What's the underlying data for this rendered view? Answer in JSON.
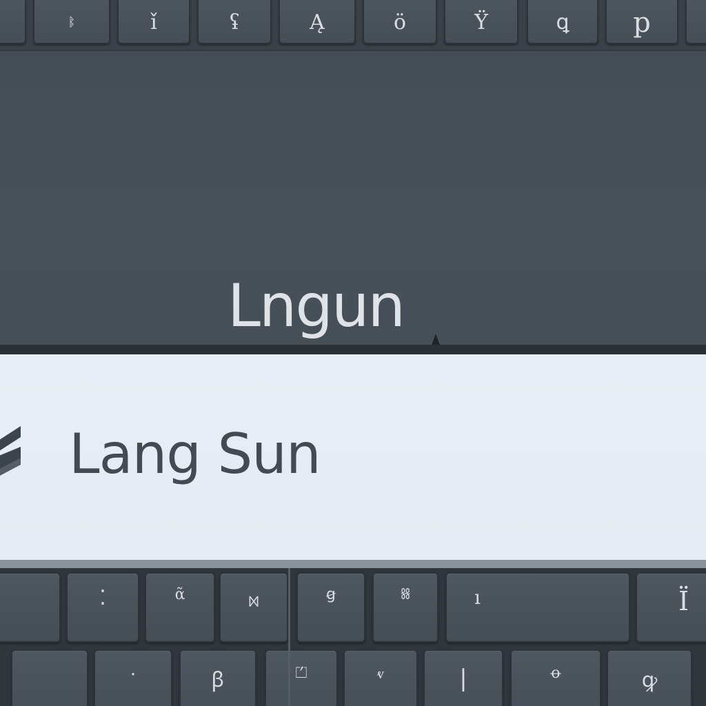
{
  "screen": {
    "dark_panel_text": "Lngun",
    "light_bar_text": "Lang Sun"
  },
  "keyboard_top": {
    "keys": [
      {
        "label": "",
        "name": "key-top-1"
      },
      {
        "label": "ᛔ",
        "name": "key-top-2"
      },
      {
        "label": "ǐ",
        "name": "key-top-3"
      },
      {
        "label": "ʢ",
        "name": "key-top-4"
      },
      {
        "label": "Ą",
        "name": "key-top-5"
      },
      {
        "label": "ö",
        "name": "key-top-6"
      },
      {
        "label": "Ϋ",
        "name": "key-top-7"
      },
      {
        "label": "ꝗ",
        "name": "key-top-8"
      },
      {
        "label": "p",
        "name": "key-top-9"
      },
      {
        "label": "",
        "name": "key-top-10"
      }
    ]
  },
  "keyboard_bottom": {
    "row1": [
      {
        "label": "",
        "name": "key-bottom-r1-1"
      },
      {
        "label": "⁚",
        "name": "key-bottom-r1-2"
      },
      {
        "label": "ᾶ",
        "name": "key-bottom-r1-3"
      },
      {
        "label": "ᢂ",
        "name": "key-bottom-r1-4"
      },
      {
        "label": "ꞡ",
        "name": "key-bottom-r1-5"
      },
      {
        "label": "ꗤ",
        "name": "key-bottom-r1-6"
      },
      {
        "label": "ı",
        "name": "key-bottom-r1-7"
      },
      {
        "label": "Ϊ",
        "name": "key-bottom-r1-8"
      }
    ],
    "row2": [
      {
        "label": "",
        "name": "key-bottom-r2-1"
      },
      {
        "label": "·",
        "name": "key-bottom-r2-2"
      },
      {
        "label": "ꞵ",
        "name": "key-bottom-r2-3"
      },
      {
        "label": "⏍",
        "name": "key-bottom-r2-4"
      },
      {
        "label": "ⱴ",
        "name": "key-bottom-r2-5"
      },
      {
        "label": "|",
        "name": "key-bottom-r2-6"
      },
      {
        "label": "ꝋ",
        "name": "key-bottom-r2-7"
      },
      {
        "label": "ꝙ",
        "name": "key-bottom-r2-8"
      }
    ]
  },
  "colors": {
    "dark_panel": "#474f57",
    "light_bar": "#e6ecf3",
    "key_face": "#4b545c",
    "text_dark": "#424a52",
    "text_light": "#dfe3e7"
  },
  "icons": {
    "brand_mark": "chevron-brand-icon"
  }
}
